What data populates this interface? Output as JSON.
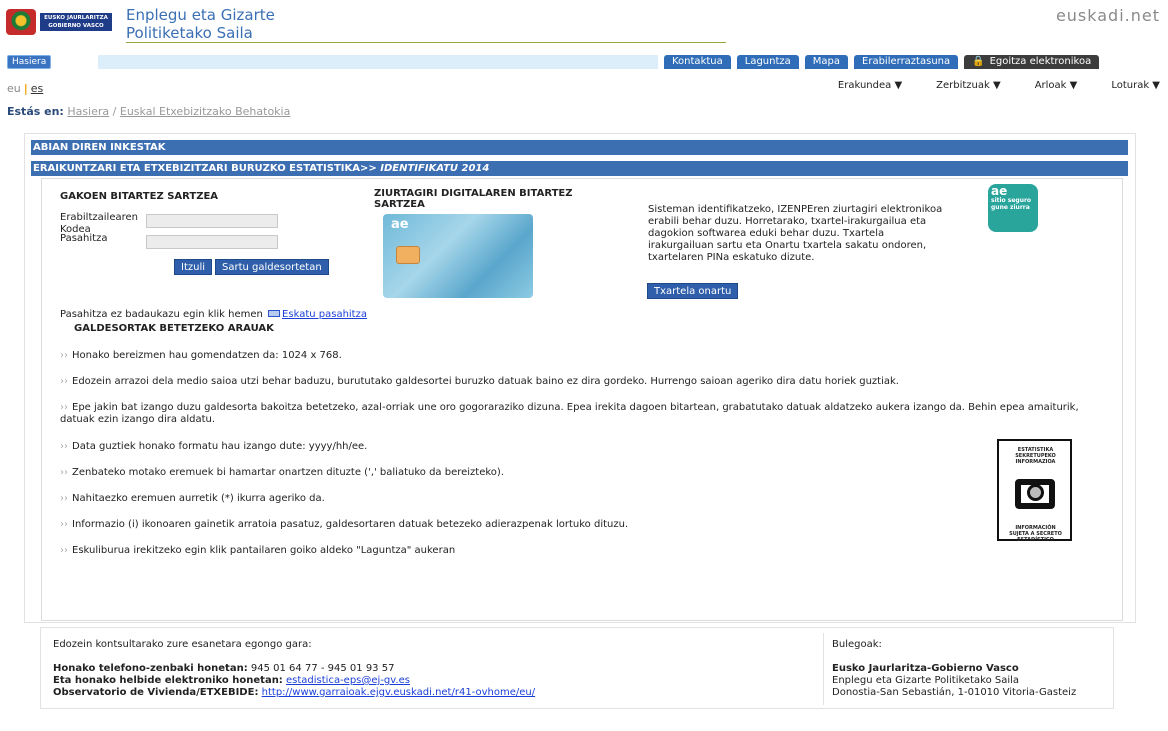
{
  "header": {
    "logo_text": "EUSKO JAURLARITZA GOBIERNO VASCO",
    "dept_line1": "Enplegu eta Gizarte",
    "dept_line2": "Politiketako Saila",
    "brand": "euskadi.net"
  },
  "nav": {
    "home": "Hasiera",
    "tabs": [
      "Kontaktua",
      "Laguntza",
      "Mapa",
      "Erabilerraztasuna"
    ],
    "egoitza": "Egoitza elektronikoa"
  },
  "lang": {
    "eu": "eu",
    "es": "es"
  },
  "menus": [
    "Erakundea ▼",
    "Zerbitzuak ▼",
    "Arloak ▼",
    "Loturak ▼"
  ],
  "breadcrumb": {
    "label": "Estás en:",
    "home": "Hasiera",
    "sep": "/",
    "current": "Euskal Etxebizitzako Behatokia"
  },
  "bars": {
    "top": "ABIAN DIREN INKESTAK",
    "second_prefix": "ERAIKUNTZARI ETA ETXEBIZITZARI BURUZKO ESTATISTIKA>> ",
    "second_em": "IDENTIFIKATU 2014"
  },
  "login": {
    "heading": "GAKOEN BITARTEZ SARTZEA",
    "user_label_1": "Erabiltzailearen",
    "user_label_2": "Kodea",
    "pass_label": "Pasahitza",
    "btn_back": "Itzuli",
    "btn_enter": "Sartu galdesortetan"
  },
  "cert": {
    "heading": "ZIURTAGIRI DIGITALAREN BITARTEZ SARTZEA",
    "card_logo": "ae",
    "text": "Sisteman identifikatzeko, IZENPEren ziurtagiri elektronikoa erabili behar duzu. Horretarako, txartel-irakurgailua eta dagokion softwarea eduki behar duzu. Txartela irakurgailuan sartu eta Onartu txartela sakatu ondoren, txartelaren PINa eskatuko dizute.",
    "btn": "Txartela onartu",
    "badge_logo": "ae",
    "badge_text": "sitio seguro",
    "badge_small": "gune ziurra"
  },
  "password": {
    "text": "Pasahitza ez badaukazu egin klik hemen",
    "link": "Eskatu pasahitza"
  },
  "rules": {
    "heading": "GALDESORTAK BETETZEKO ARAUAK",
    "items": [
      "Honako bereizmen hau gomendatzen da: 1024 x 768.",
      "Edozein arrazoi dela medio saioa utzi behar baduzu, burututako galdesortei buruzko datuak baino ez dira gordeko. Hurrengo saioan ageriko dira datu horiek guztiak.",
      "Epe jakin bat izango duzu galdesorta bakoitza betetzeko, azal-orriak une oro gogoraraziko dizuna. Epea irekita dagoen bitartean, grabatutako datuak aldatzeko aukera izango da. Behin epea amaiturik, datuak ezin izango dira aldatu.",
      "Data guztiek honako formatu hau izango dute: yyyy/hh/ee.",
      "Zenbateko motako eremuek bi hamartar onartzen dituzte (',' baliatuko da bereizteko).",
      "Nahitaezko eremuen aurretik (*) ikurra ageriko da.",
      "Informazio (i) ikonoaren gainetik arratoia pasatuz, galdesortaren datuak betezeko adierazpenak lortuko dituzu.",
      "Eskuliburua irekitzeko egin klik pantailaren goiko aldeko \"Laguntza\" aukeran"
    ],
    "bullet": "››"
  },
  "stamp": {
    "top": "ESTATISTIKA SEKRETUPEKO INFORMAZIOA",
    "bottom": "INFORMACIÓN SUJETA A SECRETO ESTADÍSTICO"
  },
  "footer": {
    "intro": "Edozein kontsultarako zure esanetara egongo gara:",
    "phone_label": "Honako telefono-zenbaki honetan:",
    "phone_value": " 945 01 64 77 - 945 01 93 57",
    "email_label": "Eta honako helbide elektroniko honetan:",
    "email_value": "estadistica-eps@ej-gv.es",
    "obs_label": "Observatorio de Vivienda/ETXEBIDE:",
    "obs_value": "http://www.garraioak.ejgv.euskadi.net/r41-ovhome/eu/",
    "office_label": "Bulegoak:",
    "office_name": "Eusko Jaurlaritza-Gobierno Vasco",
    "office_dept": "Enplegu eta Gizarte Politiketako Saila",
    "office_addr": "Donostia-San Sebastián, 1-01010 Vitoria-Gasteiz"
  }
}
